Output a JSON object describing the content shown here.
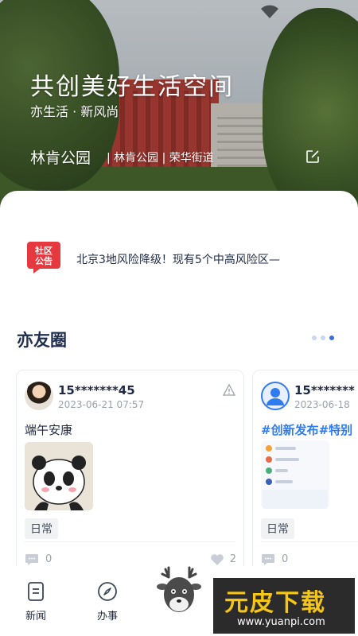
{
  "hero": {
    "title": "共创美好生活空间",
    "subtitle": "亦生活 · 新风尚",
    "location": "林肯公园",
    "location_detail": "| 林肯公园 | 荣华街道"
  },
  "notice": {
    "badge_text": "社区公告",
    "text": "北京3地风险降级！现有5个中高风险区—"
  },
  "circle": {
    "title": "亦友圈",
    "pager": {
      "total": 3,
      "active": 3
    }
  },
  "posts": [
    {
      "username": "15*******45",
      "time": "2023-06-21  07:57",
      "text": "端午安康",
      "tag": "日常",
      "comments": "0",
      "likes": "2"
    },
    {
      "username": "15*******",
      "time": "2023-06-18",
      "text": "#创新发布#特别",
      "tag": "日常",
      "comments": "0",
      "likes": ""
    }
  ],
  "nav": {
    "items": [
      {
        "label": "新闻",
        "icon": "news-icon"
      },
      {
        "label": "办事",
        "icon": "compass-icon"
      }
    ]
  },
  "watermark": {
    "title": "元皮下载",
    "url": "www.yuanpi.com"
  },
  "colors": {
    "accent": "#2f7cf0",
    "title_navy": "#1f2e4d",
    "notice_red": "#e5393f"
  }
}
